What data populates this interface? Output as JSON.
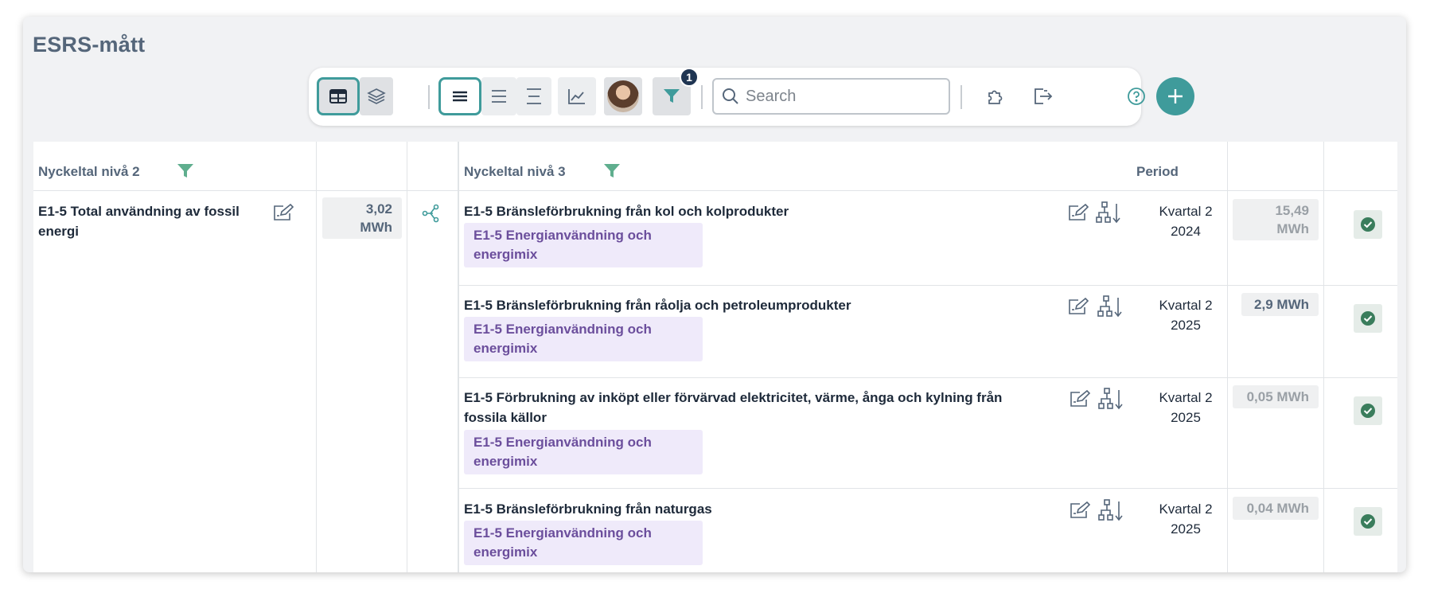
{
  "page": {
    "title": "ESRS-mått"
  },
  "toolbar": {
    "filter_badge": "1",
    "search_placeholder": "Search"
  },
  "table": {
    "headers": {
      "level2": "Nyckeltal nivå 2",
      "level3": "Nyckeltal nivå 3",
      "period": "Period"
    },
    "level2_row": {
      "label": "E1-5 Total användning av fossil energi",
      "value": "3,02 MWh"
    },
    "rows": [
      {
        "label": "E1-5 Bränsleförbrukning från kol och kolprodukter",
        "tag": "E1-5 Energianvändning och energimix",
        "period_q": "Kvartal 2",
        "period_y": "2024",
        "value": "15,49 MWh"
      },
      {
        "label": "E1-5 Bränsleförbrukning från råolja och petroleumprodukter",
        "tag": "E1-5 Energianvändning och energimix",
        "period_q": "Kvartal 2",
        "period_y": "2025",
        "value": "2,9 MWh"
      },
      {
        "label": "E1-5 Förbrukning av inköpt eller förvärvad elektricitet, värme, ånga och kylning från fossila källor",
        "tag": "E1-5 Energianvändning och energimix",
        "period_q": "Kvartal 2",
        "period_y": "2025",
        "value": "0,05 MWh"
      },
      {
        "label": "E1-5 Bränsleförbrukning från naturgas",
        "tag": "E1-5 Energianvändning och energimix",
        "period_q": "Kvartal 2",
        "period_y": "2025",
        "value": "0,04 MWh"
      }
    ]
  },
  "colors": {
    "accent": "#3f9b9b",
    "filter": "#5fae8e",
    "tag_bg": "#efeafa",
    "tag_text": "#6b4e9c",
    "check": "#3a7d5c"
  }
}
